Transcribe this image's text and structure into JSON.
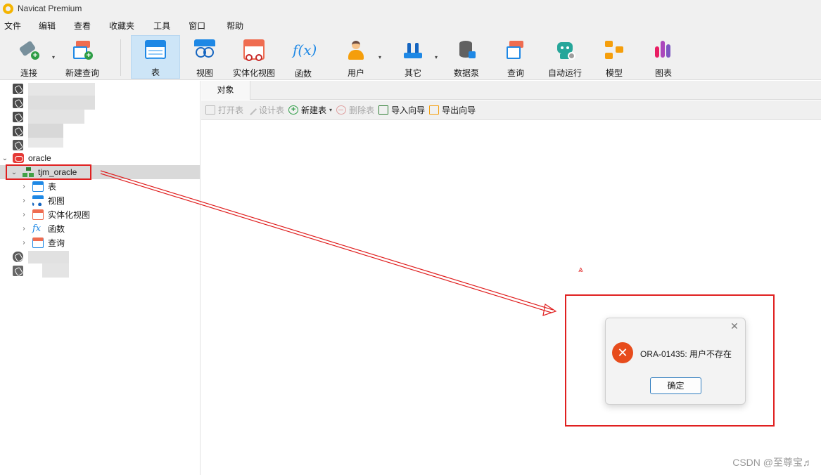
{
  "window": {
    "title": "Navicat Premium"
  },
  "menubar": {
    "items": [
      "文件",
      "编辑",
      "查看",
      "收藏夹",
      "工具",
      "窗口",
      "帮助"
    ]
  },
  "toolbar": {
    "connect": "连接",
    "new_query": "新建查询",
    "table": "表",
    "view": "视图",
    "mat_view": "实体化视图",
    "function": "函数",
    "user": "用户",
    "other": "其它",
    "data_pump": "数据泵",
    "query": "查询",
    "automation": "自动运行",
    "model": "模型",
    "chart": "图表",
    "active_tool": "表"
  },
  "tree": {
    "oracle_connection": "oracle",
    "schema": "tjm_oracle",
    "children": [
      "表",
      "视图",
      "实体化视图",
      "函数",
      "查询"
    ]
  },
  "tabs": {
    "objects": "对象"
  },
  "object_toolbar": {
    "open_table": "打开表",
    "design_table": "设计表",
    "new_table": "新建表",
    "delete_table": "删除表",
    "import_wizard": "导入向导",
    "export_wizard": "导出向导"
  },
  "dialog": {
    "message": "ORA-01435: 用户不存在",
    "ok_label": "确定",
    "close_glyph": "✕"
  },
  "watermark": "CSDN @至尊宝♬",
  "colors": {
    "highlight_red": "#e02020",
    "accent_blue": "#1e88e5",
    "error_orange": "#e74c1c"
  }
}
